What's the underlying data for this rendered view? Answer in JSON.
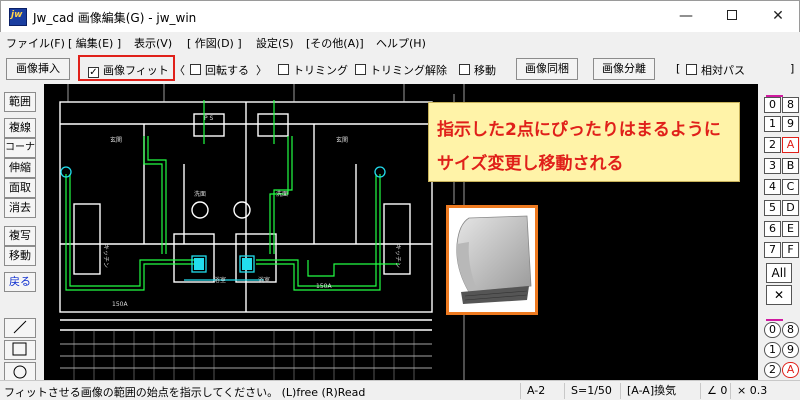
{
  "window": {
    "title": "Jw_cad 画像編集(G) - jw_win",
    "icon_label": "jw",
    "controls": {
      "minimize": "—",
      "maximize": "",
      "close": "✕"
    }
  },
  "menu": [
    "ファイル(F)",
    "[ 編集(E) ]",
    "表示(V)",
    "[ 作図(D) ]",
    "設定(S)",
    "[その他(A)]",
    "ヘルプ(H)"
  ],
  "toolbar": {
    "insert_image": "画像挿入",
    "fit_image": {
      "label": "画像フィット",
      "checked": true,
      "mark": "✓"
    },
    "paren_open": "〈",
    "rotate": {
      "label": "回転する",
      "checked": false
    },
    "paren_close": "〉",
    "trimming": {
      "label": "トリミング",
      "checked": false
    },
    "trimming_release": {
      "label": "トリミング解除",
      "checked": false
    },
    "move": {
      "label": "移動",
      "checked": false
    },
    "image_bundle": "画像同梱",
    "image_separate": "画像分離",
    "bracket_open": "[",
    "relative_path": {
      "label": "相対パス",
      "checked": false
    },
    "bracket_close": "]"
  },
  "left_tools": [
    "範囲",
    "複線",
    "コーナー",
    "伸縮",
    "面取",
    "消去",
    "複写",
    "移動",
    "戻る"
  ],
  "left_shapes": [
    "line-icon",
    "rectangle-icon",
    "circle-icon"
  ],
  "right_layers": {
    "left_col": [
      "0",
      "1",
      "2",
      "3",
      "4",
      "5",
      "6",
      "7"
    ],
    "right_col": [
      "8",
      "9",
      "A",
      "B",
      "C",
      "D",
      "E",
      "F"
    ],
    "all_label": "All",
    "cross": "✕",
    "groups_left": [
      "0",
      "1",
      "2"
    ],
    "groups_right": [
      "8",
      "9",
      "A"
    ]
  },
  "annotation": {
    "line1": "指示した2点にぴったりはまるように",
    "line2": "サイズ変更し移動される"
  },
  "drawing_labels": {
    "entrance_1": "玄関",
    "entrance_2": "玄関",
    "kitchen_1": "キッチン",
    "kitchen_2": "キッチン",
    "bath_1": "浴室",
    "bath_2": "浴室",
    "washroom_1": "洗面",
    "washroom_2": "洗面",
    "dim_150a_1": "150A",
    "dim_150a_2": "150A",
    "ps": "P S"
  },
  "status": {
    "message": "フィットさせる画像の範囲の始点を指示してください。 (L)free (R)Read",
    "paper": "A-2",
    "scale": "S=1/50",
    "layer": "[A-A]換気",
    "angle": "∠ 0",
    "multiplier": "× 0.3"
  }
}
